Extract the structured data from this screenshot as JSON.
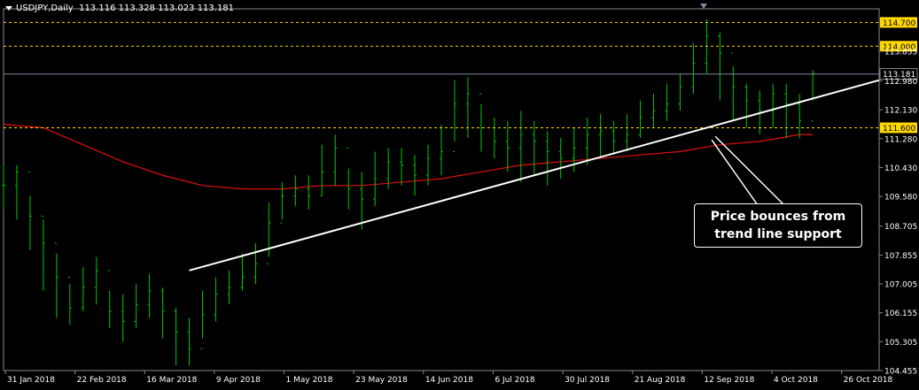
{
  "header": {
    "symbol": "USDJPY,Daily",
    "ohlc": "113.116 113.328 113.023 113.181"
  },
  "colors": {
    "background": "#000000",
    "bars": "#00c800",
    "moving_average": "#e01010",
    "level_line": "#ffd700",
    "current_price_line": "#7a8ba0",
    "trend_line": "#ffffff",
    "axis_text": "#ffffff"
  },
  "chart_data": {
    "type": "line",
    "y_ticks": [
      "113.855",
      "112.980",
      "112.130",
      "111.280",
      "110.430",
      "109.580",
      "108.705",
      "107.855",
      "107.005",
      "106.155",
      "105.305",
      "104.455"
    ],
    "x_ticks": [
      "31 Jan 2018",
      "22 Feb 2018",
      "16 Mar 2018",
      "9 Apr 2018",
      "1 May 2018",
      "23 May 2018",
      "14 Jun 2018",
      "6 Jul 2018",
      "30 Jul 2018",
      "21 Aug 2018",
      "12 Sep 2018",
      "4 Oct 2018",
      "26 Oct 2018"
    ],
    "ylim": [
      104.455,
      115.1
    ],
    "levels": [
      {
        "label": "114.700",
        "value": 114.7
      },
      {
        "label": "114.000",
        "value": 114.0
      },
      {
        "label": "111.600",
        "value": 111.6
      }
    ],
    "current_price": {
      "label": "113.181",
      "value": 113.181
    },
    "price_series": {
      "name": "",
      "x": [
        0,
        4,
        8,
        12,
        16,
        20,
        24,
        28,
        32,
        36,
        40,
        44,
        48,
        52,
        56,
        60,
        64,
        68,
        72,
        76,
        80,
        84,
        88,
        92,
        96,
        100,
        104,
        108,
        112,
        116,
        120,
        124,
        128,
        132,
        136,
        140,
        144,
        148,
        152,
        156,
        160,
        164,
        168,
        172,
        176,
        180,
        184,
        188,
        192,
        196,
        200,
        204,
        208,
        212,
        216,
        220,
        224,
        228,
        232,
        236,
        240,
        244
      ],
      "y": [
        109.9,
        110.3,
        109.0,
        108.2,
        107.2,
        106.3,
        106.9,
        107.4,
        106.2,
        105.9,
        106.4,
        106.8,
        106.2,
        105.6,
        105.1,
        106.1,
        106.7,
        106.9,
        107.2,
        107.6,
        108.8,
        109.6,
        109.8,
        109.6,
        110.3,
        111.0,
        109.8,
        109.5,
        110.1,
        110.6,
        110.5,
        110.2,
        110.7,
        110.9,
        112.3,
        112.6,
        111.6,
        111.2,
        111.0,
        111.4,
        111.2,
        110.9,
        110.7,
        111.0,
        111.4,
        111.5,
        111.2,
        111.4,
        111.9,
        112.1,
        112.3,
        112.8,
        113.5,
        114.3,
        113.8,
        112.8,
        112.4,
        112.1,
        112.6,
        112.3,
        111.8,
        113.2
      ],
      "low": [
        109.2,
        108.9,
        108.0,
        106.8,
        106.0,
        105.8,
        106.2,
        106.4,
        105.7,
        105.3,
        105.7,
        106.0,
        105.4,
        104.6,
        104.6,
        105.4,
        105.9,
        106.4,
        106.8,
        107.0,
        107.8,
        108.9,
        109.3,
        109.2,
        109.6,
        109.9,
        109.2,
        108.6,
        109.3,
        109.8,
        109.9,
        109.6,
        109.9,
        110.2,
        111.2,
        111.3,
        110.9,
        110.7,
        110.3,
        110.0,
        110.2,
        109.9,
        110.1,
        110.3,
        110.5,
        110.7,
        110.8,
        110.9,
        111.3,
        111.6,
        111.8,
        112.1,
        112.6,
        113.2,
        112.4,
        111.8,
        111.6,
        111.4,
        111.6,
        111.3,
        111.3,
        112.4
      ],
      "high": [
        110.5,
        110.5,
        109.6,
        108.9,
        107.9,
        107.0,
        107.5,
        107.8,
        106.8,
        106.7,
        107.0,
        107.3,
        106.9,
        106.3,
        106.0,
        106.8,
        107.2,
        107.4,
        107.9,
        108.2,
        109.4,
        110.0,
        110.2,
        110.2,
        111.1,
        111.4,
        110.4,
        110.3,
        110.9,
        111.0,
        111.0,
        110.8,
        111.1,
        111.7,
        113.0,
        113.1,
        112.3,
        111.9,
        111.8,
        112.1,
        111.8,
        111.5,
        111.3,
        111.6,
        111.9,
        112.0,
        111.8,
        112.0,
        112.4,
        112.6,
        112.9,
        113.2,
        114.1,
        114.8,
        114.4,
        113.4,
        112.9,
        112.7,
        112.9,
        112.9,
        112.6,
        113.3
      ]
    },
    "moving_average": {
      "name": "",
      "x": [
        0,
        12,
        24,
        36,
        48,
        60,
        72,
        84,
        96,
        108,
        120,
        132,
        144,
        156,
        168,
        180,
        192,
        204,
        216,
        228,
        240,
        244
      ],
      "y": [
        111.7,
        111.6,
        111.1,
        110.6,
        110.2,
        109.9,
        109.8,
        109.8,
        109.9,
        109.9,
        110.0,
        110.1,
        110.3,
        110.5,
        110.6,
        110.7,
        110.8,
        110.9,
        111.1,
        111.2,
        111.4,
        111.4
      ]
    },
    "trend_line": {
      "x": [
        56,
        264
      ],
      "y": [
        107.4,
        113.0
      ]
    },
    "annotation": {
      "line1": "Price bounces from",
      "line2": "trend line support"
    }
  }
}
